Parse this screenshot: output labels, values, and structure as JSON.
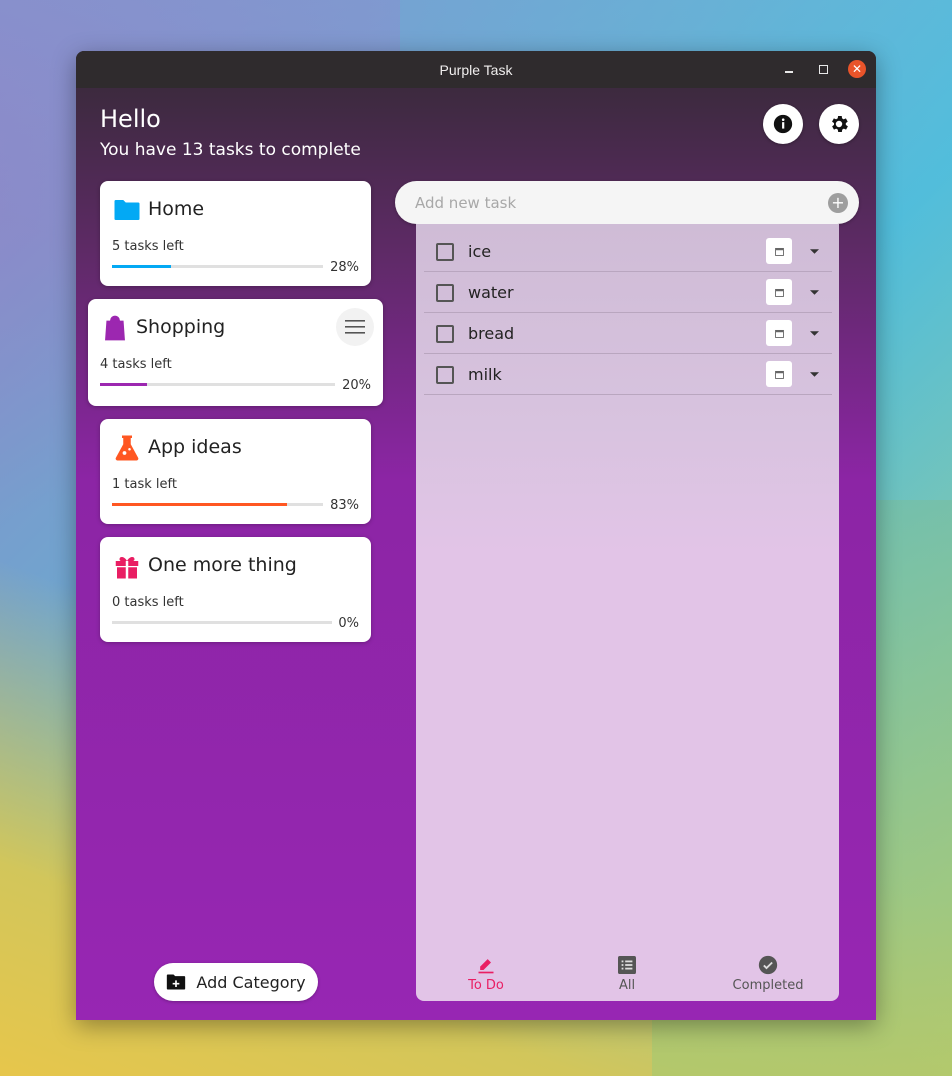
{
  "window": {
    "title": "Purple Task"
  },
  "header": {
    "greeting": "Hello",
    "subtitle": "You have 13 tasks to complete"
  },
  "categories": [
    {
      "name": "Home",
      "tasks_left": "5 tasks left",
      "percent_label": "28%",
      "progress": 0.28,
      "color": "#03a9f4",
      "icon": "folder-icon"
    },
    {
      "name": "Shopping",
      "tasks_left": "4 tasks left",
      "percent_label": "20%",
      "progress": 0.2,
      "color": "#9c27b0",
      "icon": "shopping-bag-icon",
      "selected": true
    },
    {
      "name": "App ideas",
      "tasks_left": "1 task left",
      "percent_label": "83%",
      "progress": 0.83,
      "color": "#ff5722",
      "icon": "flask-icon"
    },
    {
      "name": "One more thing",
      "tasks_left": "0 tasks left",
      "percent_label": "0%",
      "progress": 0.0,
      "color": "#e91e63",
      "icon": "gift-icon"
    }
  ],
  "add_category_label": "Add Category",
  "new_task": {
    "placeholder": "Add new task",
    "value": ""
  },
  "tasks": [
    {
      "text": "ice",
      "done": false
    },
    {
      "text": "water",
      "done": false
    },
    {
      "text": "bread",
      "done": false
    },
    {
      "text": "milk",
      "done": false
    }
  ],
  "bottom_nav": {
    "todo": "To Do",
    "all": "All",
    "completed": "Completed",
    "active": "todo",
    "active_color": "#e91e63"
  }
}
